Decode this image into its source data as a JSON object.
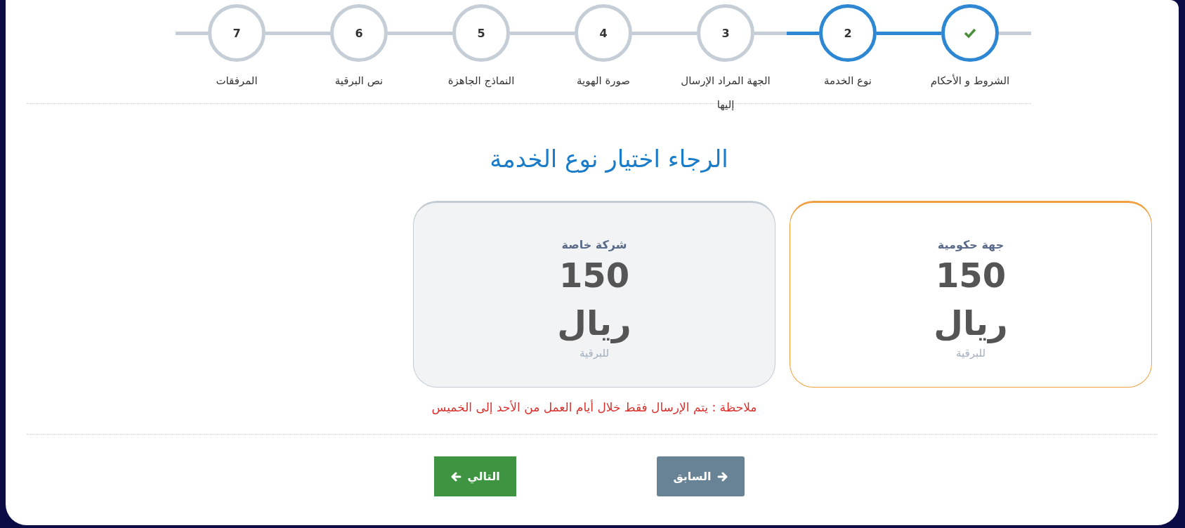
{
  "steps": [
    {
      "label": "الشروط و الأحكام",
      "done": true,
      "current": false
    },
    {
      "number": "2",
      "label": "نوع الخدمة",
      "done": false,
      "current": true
    },
    {
      "number": "3",
      "label": "الجهة المراد الإرسال إليها",
      "done": false,
      "current": false
    },
    {
      "number": "4",
      "label": "صورة الهوية",
      "done": false,
      "current": false
    },
    {
      "number": "5",
      "label": "النماذج الجاهزة",
      "done": false,
      "current": false
    },
    {
      "number": "6",
      "label": "نص البرقية",
      "done": false,
      "current": false
    },
    {
      "number": "7",
      "label": "المرفقات",
      "done": false,
      "current": false
    }
  ],
  "heading": "الرجاء اختيار نوع الخدمة",
  "options": [
    {
      "title": "جهة حكومية",
      "price": "150",
      "currency": "ريال",
      "unit": "للبرقية",
      "selected": true
    },
    {
      "title": "شركة خاصة",
      "price": "150",
      "currency": "ريال",
      "unit": "للبرقية",
      "selected": false
    }
  ],
  "note": "ملاحظة : يتم الإرسال فقط خلال أيام العمل من الأحد إلى الخميس",
  "buttons": {
    "next": "التالي",
    "previous": "السابق"
  }
}
